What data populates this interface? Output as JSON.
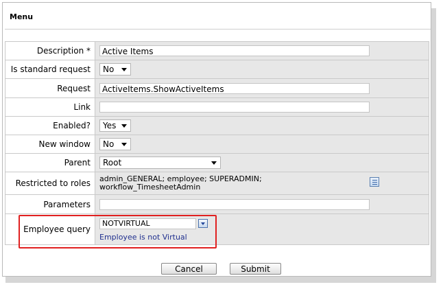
{
  "panel": {
    "title": "Menu"
  },
  "fields": {
    "description": {
      "label": "Description *",
      "value": "Active Items"
    },
    "standard_request": {
      "label": "Is standard request",
      "value": "No"
    },
    "request": {
      "label": "Request",
      "value": "ActiveItems.ShowActiveItems"
    },
    "link": {
      "label": "Link",
      "value": ""
    },
    "enabled": {
      "label": "Enabled?",
      "value": "Yes"
    },
    "new_window": {
      "label": "New window",
      "value": "No"
    },
    "parent": {
      "label": "Parent",
      "value": "Root"
    },
    "restricted_roles": {
      "label": "Restricted to roles",
      "line1": "admin_GENERAL; employee; SUPERADMIN;",
      "line2": "workflow_TimesheetAdmin",
      "icon": "list-icon"
    },
    "parameters": {
      "label": "Parameters",
      "value": ""
    },
    "employee_query": {
      "label": "Employee query",
      "value": "NOTVIRTUAL",
      "description": "Employee is not Virtual",
      "icon": "dropdown-arrow-icon"
    }
  },
  "buttons": {
    "cancel": "Cancel",
    "submit": "Submit"
  },
  "colors": {
    "highlight": "#e02020",
    "link_text": "#1f2f8e",
    "value_bg": "#e7e7e7"
  }
}
